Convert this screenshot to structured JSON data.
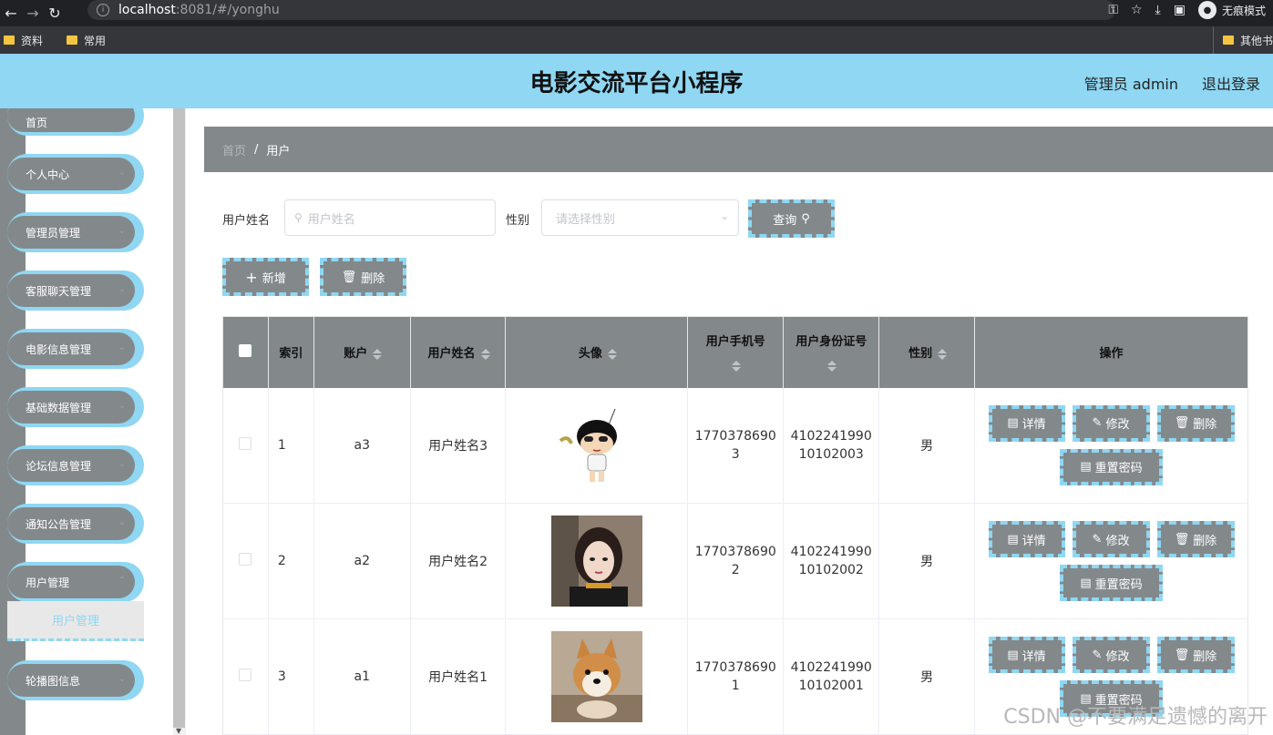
{
  "browser": {
    "host": "localhost",
    "path": ":8081/#/yonghu",
    "mode_label": "无痕模式",
    "bookmarks": [
      "资料",
      "常用"
    ],
    "other_bookmarks": "其他书"
  },
  "header": {
    "title": "电影交流平台小程序",
    "user": "管理员 admin",
    "logout": "退出登录"
  },
  "sidebar": {
    "items": [
      {
        "label": "首页"
      },
      {
        "label": "个人中心"
      },
      {
        "label": "管理员管理"
      },
      {
        "label": "客服聊天管理"
      },
      {
        "label": "电影信息管理"
      },
      {
        "label": "基础数据管理"
      },
      {
        "label": "论坛信息管理"
      },
      {
        "label": "通知公告管理"
      },
      {
        "label": "用户管理"
      },
      {
        "label": "轮播图信息"
      }
    ],
    "active_sub": "用户管理"
  },
  "breadcrumb": {
    "home": "首页",
    "sep": "/",
    "current": "用户"
  },
  "search": {
    "name_label": "用户姓名",
    "name_placeholder": "用户姓名",
    "gender_label": "性别",
    "gender_placeholder": "请选择性别",
    "query_btn": "查询"
  },
  "actions": {
    "add": "新增",
    "delete": "删除"
  },
  "table": {
    "headers": {
      "index": "索引",
      "account": "账户",
      "name": "用户姓名",
      "avatar": "头像",
      "phone": "用户手机号",
      "id_card": "用户身份证号",
      "gender": "性别",
      "ops": "操作"
    },
    "rows": [
      {
        "index": "1",
        "account": "a3",
        "name": "用户姓名3",
        "phone_a": "1770378690",
        "phone_b": "3",
        "id_a": "4102241990",
        "id_b": "10102003",
        "gender": "男",
        "avatar": "cartoon"
      },
      {
        "index": "2",
        "account": "a2",
        "name": "用户姓名2",
        "phone_a": "1770378690",
        "phone_b": "2",
        "id_a": "4102241990",
        "id_b": "10102002",
        "gender": "男",
        "avatar": "photo-girl"
      },
      {
        "index": "3",
        "account": "a1",
        "name": "用户姓名1",
        "phone_a": "1770378690",
        "phone_b": "1",
        "id_a": "4102241990",
        "id_b": "10102001",
        "gender": "男",
        "avatar": "photo-dog"
      }
    ],
    "op_labels": {
      "detail": "详情",
      "edit": "修改",
      "delete": "删除",
      "reset": "重置密码"
    }
  },
  "watermark": "CSDN @不要满足遗憾的离开"
}
